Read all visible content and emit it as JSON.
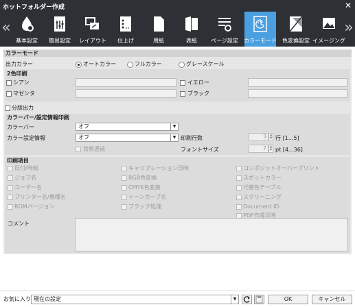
{
  "window": {
    "title": "ホットフォルダー作成",
    "close_glyph": "✕"
  },
  "toolbar": {
    "prev_glyph": "«",
    "next_glyph": "»",
    "tabs": [
      {
        "label": "基本設定",
        "icon": "drop-gear-icon"
      },
      {
        "label": "簡易設定",
        "icon": "doc-settings-icon"
      },
      {
        "label": "レイアウト",
        "icon": "layout-icon"
      },
      {
        "label": "仕上げ",
        "icon": "finishing-icon"
      },
      {
        "label": "用紙",
        "icon": "paper-icon"
      },
      {
        "label": "表紙",
        "icon": "cover-icon"
      },
      {
        "label": "ページ設定",
        "icon": "page-settings-icon"
      },
      {
        "label": "カラーモード",
        "icon": "palette-icon",
        "active": true
      },
      {
        "label": "色変換設定",
        "icon": "color-conversion-icon"
      },
      {
        "label": "イメージング",
        "icon": "imaging-icon"
      }
    ],
    "active_color": "#4a9fe0"
  },
  "color_mode": {
    "section": "カラーモード",
    "output_color_label": "出力カラー",
    "options": [
      "オートカラー",
      "フルカラー",
      "グレースケール"
    ],
    "selected": "オートカラー"
  },
  "two_color": {
    "section": "2色印刷",
    "items": [
      "シアン",
      "マゼンタ",
      "イエロー",
      "ブラック"
    ]
  },
  "separation_label": "分版出力",
  "color_bar": {
    "section": "カラーバー/設定情報印刷",
    "color_bar_label": "カラーバー",
    "color_bar_value": "オフ",
    "settings_info_label": "カラー設定情報",
    "settings_info_value": "オフ",
    "transparent_bg_label": "背景透過",
    "print_lines_label": "印刷行数",
    "print_lines_value": "3",
    "print_lines_unit": "行 [1...5]",
    "font_size_label": "フォントサイズ",
    "font_size_value": "7",
    "font_size_unit": "pt [4...36]"
  },
  "print_items": {
    "section": "印刷項目",
    "col1": [
      "日付/時刻",
      "ジョブ名",
      "ユーザー名",
      "プリンター名/機種名",
      "ROMバージョン"
    ],
    "col2": [
      "キャリブレーション日時",
      "RGB色変換",
      "CMYK色変換",
      "トーンカーブ名",
      "ブラック処理"
    ],
    "col3": [
      "コンポジットオーバープリント",
      "スポットカラー",
      "代替色テーブル",
      "スクリーニング",
      "Document ID",
      "PDF作成日時"
    ],
    "comment_label": "コメント"
  },
  "footer": {
    "favorites_label": "お気に入り",
    "favorites_value": "現在の設定",
    "ok_label": "OK",
    "cancel_label": "キャンセル"
  }
}
